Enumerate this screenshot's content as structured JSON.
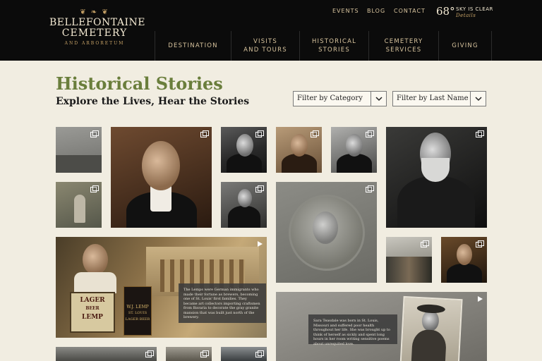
{
  "logo": {
    "line1": "BELLEFONTAINE",
    "line2": "CEMETERY",
    "line3": "AND ARBORETUM"
  },
  "utility_nav": [
    "EVENTS",
    "BLOG",
    "CONTACT"
  ],
  "weather": {
    "temp": "68°",
    "condition": "SKY IS CLEAR",
    "details_label": "Details"
  },
  "main_nav": [
    {
      "label": "DESTINATION"
    },
    {
      "label": "VISITS AND TOURS"
    },
    {
      "label": "HISTORICAL STORIES"
    },
    {
      "label": "CEMETERY SERVICES"
    },
    {
      "label": "GIVING"
    }
  ],
  "page": {
    "title": "Historical Stories",
    "subtitle": "Explore the Lives, Hear the Stories"
  },
  "filters": {
    "category": "Filter by Category",
    "last_name": "Filter by Last Name"
  },
  "lemp_feature": {
    "caption": "The Lemps were German immigrants who made their fortune as brewers, becoming one of St. Louis' first families. They became art collectors importing craftsmen from Bavaria to decorate the gray granite mansion that was built just north of the brewery.",
    "sign_line1": "LAGER",
    "sign_line2": "BEER",
    "sign_line3": "LEMP",
    "bottle_line1": "W.J. LEMP",
    "bottle_line2": "ST. LOUIS",
    "bottle_line3": "LAGER BEER"
  },
  "teasdale_feature": {
    "caption": "Sara Teasdale was born in St. Louis, Missouri and suffered poor health throughout her life. She was brought up to think of herself as sickly and spent long hours in her room writing sensitive poems about unrequited love."
  },
  "colors": {
    "header_bg": "#0b0b0b",
    "nav_text": "#d8c49e",
    "title_green": "#6a7e3c",
    "page_bg": "#f1ede1"
  },
  "icons": [
    "gallery-icon",
    "play-icon",
    "chevron-down-icon"
  ]
}
